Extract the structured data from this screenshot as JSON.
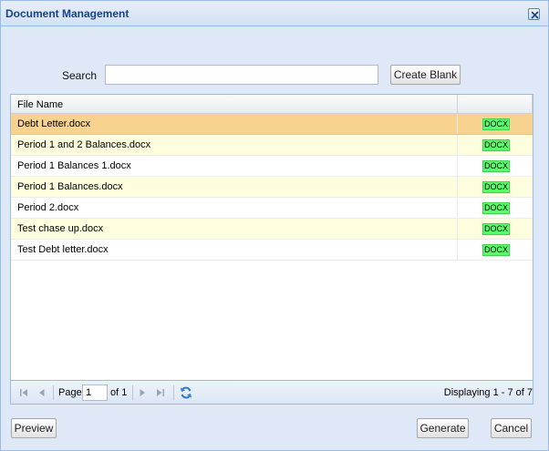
{
  "window": {
    "title": "Document Management"
  },
  "search": {
    "label": "Search",
    "value": "",
    "placeholder": ""
  },
  "toolbar": {
    "create_blank_label": "Create Blank"
  },
  "grid": {
    "columns": [
      {
        "label": "File Name"
      },
      {
        "label": ""
      }
    ],
    "rows": [
      {
        "name": "Debt Letter.docx",
        "type": "DOCX",
        "selected": true
      },
      {
        "name": "Period 1 and 2 Balances.docx",
        "type": "DOCX"
      },
      {
        "name": "Period 1 Balances 1.docx",
        "type": "DOCX"
      },
      {
        "name": "Period 1 Balances.docx",
        "type": "DOCX"
      },
      {
        "name": "Period 2.docx",
        "type": "DOCX"
      },
      {
        "name": "Test chase up.docx",
        "type": "DOCX"
      },
      {
        "name": "Test Debt letter.docx",
        "type": "DOCX"
      }
    ]
  },
  "pager": {
    "page_label": "Page",
    "page_value": "1",
    "of_label": "of 1",
    "display_info": "Displaying 1 - 7 of 7"
  },
  "footer": {
    "preview_label": "Preview",
    "generate_label": "Generate",
    "cancel_label": "Cancel"
  },
  "colors": {
    "title": "#15428b",
    "selected_row": "#f7d38f",
    "alt_row": "#fefdde",
    "badge": "#59ff6a",
    "window_bg": "#dfe8f6"
  },
  "icons": [
    "close-icon",
    "first-page-icon",
    "previous-page-icon",
    "next-page-icon",
    "last-page-icon",
    "refresh-icon"
  ]
}
